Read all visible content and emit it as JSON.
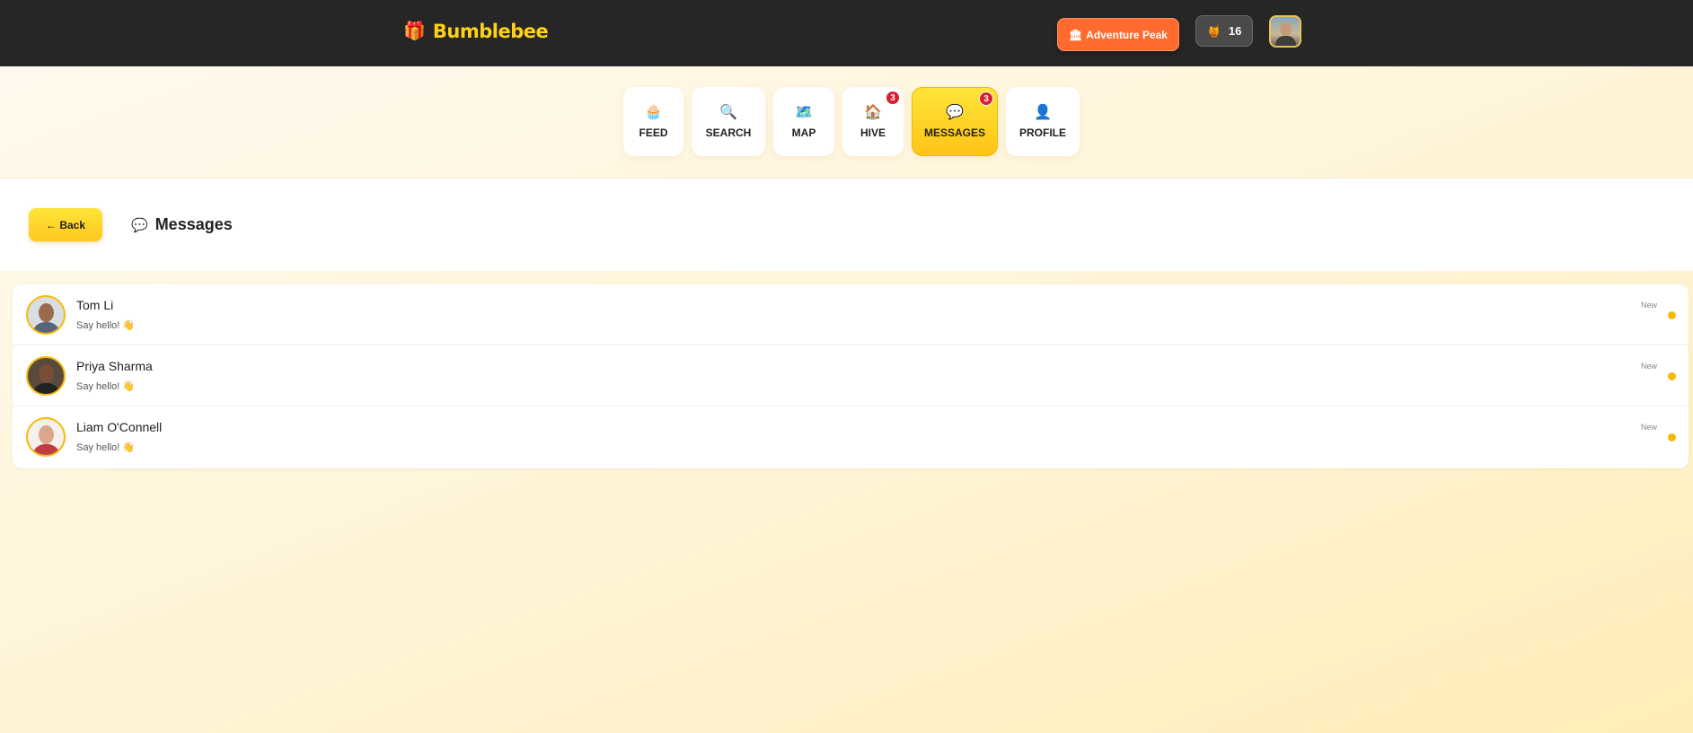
{
  "header": {
    "brand_icon": "🎁",
    "brand_name": "Bumblebee",
    "location_icon": "🏛",
    "location_label": "Adventure Peak",
    "honey_icon": "🍯",
    "honey_count": "16"
  },
  "nav": {
    "items": [
      {
        "icon": "🧁",
        "label": "FEED"
      },
      {
        "icon": "🔍",
        "label": "SEARCH"
      },
      {
        "icon": "🗺️",
        "label": "MAP"
      },
      {
        "icon": "🏠",
        "label": "HIVE",
        "badge": "3"
      },
      {
        "icon": "💬",
        "label": "MESSAGES",
        "badge": "3"
      },
      {
        "icon": "👤",
        "label": "PROFILE"
      }
    ]
  },
  "page": {
    "back_label": "← Back",
    "title_icon": "💬",
    "title": "Messages"
  },
  "conversations": [
    {
      "name": "Tom Li",
      "preview": "Say hello! 👋",
      "time": "New"
    },
    {
      "name": "Priya Sharma",
      "preview": "Say hello! 👋",
      "time": "New"
    },
    {
      "name": "Liam O'Connell",
      "preview": "Say hello! 👋",
      "time": "New"
    }
  ],
  "colors": {
    "topbar": "#262626",
    "brand": "#ffd21a",
    "accent_orange": "#ff6a2e",
    "accent_yellow": "#ffc417",
    "badge_red": "#d5202f",
    "unread_dot": "#f5b90a"
  }
}
